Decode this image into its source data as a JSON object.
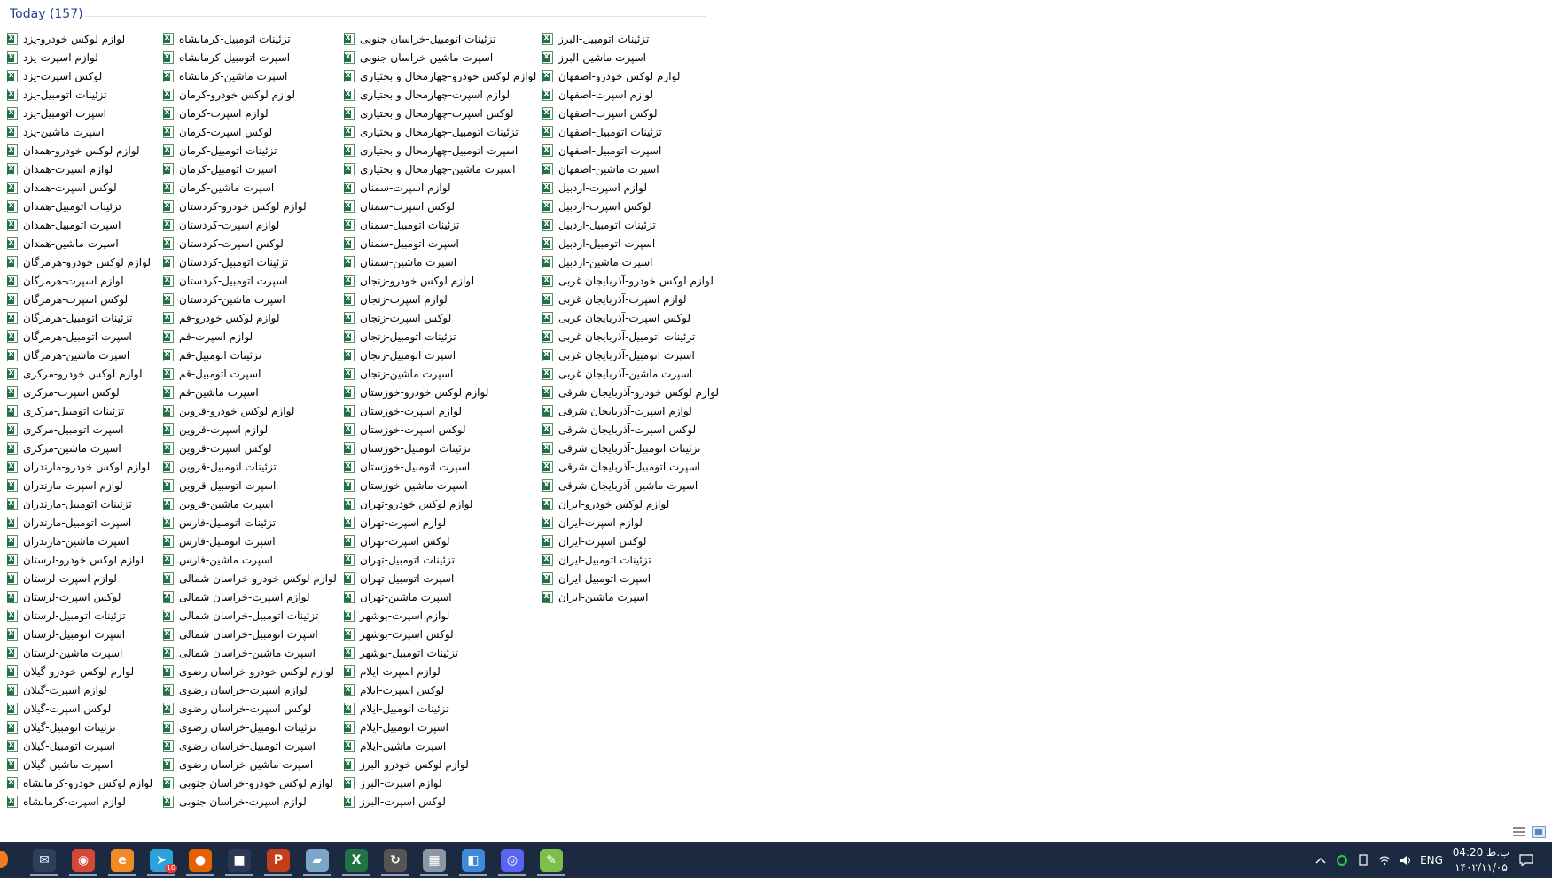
{
  "window": {
    "group_title": "Today (157)"
  },
  "columns": [
    [
      "لوازم لوکس خودرو-یزد",
      "لوازم اسپرت-یزد",
      "لوکس اسپرت-یزد",
      "تزئینات اتومبیل-یزد",
      "اسپرت اتومبیل-یزد",
      "اسپرت ماشین-یزد",
      "لوازم لوکس خودرو-همدان",
      "لوازم اسپرت-همدان",
      "لوکس اسپرت-همدان",
      "تزئینات اتومبیل-همدان",
      "اسپرت اتومبیل-همدان",
      "اسپرت ماشین-همدان",
      "لوازم لوکس خودرو-هرمزگان",
      "لوازم اسپرت-هرمزگان",
      "لوکس اسپرت-هرمزگان",
      "تزئینات اتومبیل-هرمزگان",
      "اسپرت اتومبیل-هرمزگان",
      "اسپرت ماشین-هرمزگان",
      "لوازم لوکس خودرو-مرکزی",
      "لوکس اسپرت-مرکزی",
      "تزئینات اتومبیل-مرکزی",
      "اسپرت اتومبیل-مرکزی",
      "اسپرت ماشین-مرکزی",
      "لوازم لوکس خودرو-مازندران",
      "لوازم اسپرت-مازندران",
      "تزئینات اتومبیل-مازندران",
      "اسپرت اتومبیل-مازندران",
      "اسپرت ماشین-مازندران",
      "لوازم لوکس خودرو-لرستان",
      "لوازم اسپرت-لرستان",
      "لوکس اسپرت-لرستان",
      "تزئینات اتومبیل-لرستان",
      "اسپرت اتومبیل-لرستان",
      "اسپرت ماشین-لرستان",
      "لوازم لوکس خودرو-گیلان",
      "لوازم اسپرت-گیلان",
      "لوکس اسپرت-گیلان",
      "تزئینات اتومبیل-گیلان",
      "اسپرت اتومبیل-گیلان",
      "اسپرت ماشین-گیلان",
      "لوازم لوکس خودرو-کرمانشاه",
      "لوازم اسپرت-کرمانشاه"
    ],
    [
      "تزئینات اتومبیل-کرمانشاه",
      "اسپرت اتومبیل-کرمانشاه",
      "اسپرت ماشین-کرمانشاه",
      "لوازم لوکس خودرو-کرمان",
      "لوازم اسپرت-کرمان",
      "لوکس اسپرت-کرمان",
      "تزئینات اتومبیل-کرمان",
      "اسپرت اتومبیل-کرمان",
      "اسپرت ماشین-کرمان",
      "لوازم لوکس خودرو-کردستان",
      "لوازم اسپرت-کردستان",
      "لوکس اسپرت-کردستان",
      "تزئینات اتومبیل-کردستان",
      "اسپرت اتومبیل-کردستان",
      "اسپرت ماشین-کردستان",
      "لوازم لوکس خودرو-قم",
      "لوازم اسپرت-قم",
      "تزئینات اتومبیل-قم",
      "اسپرت اتومبیل-قم",
      "اسپرت ماشین-قم",
      "لوازم لوکس خودرو-قزوین",
      "لوازم اسپرت-قزوین",
      "لوکس اسپرت-قزوین",
      "تزئینات اتومبیل-قزوین",
      "اسپرت اتومبیل-قزوین",
      "اسپرت ماشین-قزوین",
      "تزئینات اتومبیل-فارس",
      "اسپرت اتومبیل-فارس",
      "اسپرت ماشین-فارس",
      "لوازم لوکس خودرو-خراسان شمالی",
      "لوازم اسپرت-خراسان شمالی",
      "تزئینات اتومبیل-خراسان شمالی",
      "اسپرت اتومبیل-خراسان شمالی",
      "اسپرت ماشین-خراسان شمالی",
      "لوازم لوکس خودرو-خراسان رضوی",
      "لوازم اسپرت-خراسان رضوی",
      "لوکس اسپرت-خراسان رضوی",
      "تزئینات اتومبیل-خراسان رضوی",
      "اسپرت اتومبیل-خراسان رضوی",
      "اسپرت ماشین-خراسان رضوی",
      "لوازم لوکس خودرو-خراسان جنوبی",
      "لوازم اسپرت-خراسان جنوبی"
    ],
    [
      "تزئینات اتومبیل-خراسان جنوبی",
      "اسپرت ماشین-خراسان جنوبی",
      "لوازم لوکس خودرو-چهارمحال و بختیاری",
      "لوازم اسپرت-چهارمحال و بختیاری",
      "لوکس اسپرت-چهارمحال و بختیاری",
      "تزئینات اتومبیل-چهارمحال و بختیاری",
      "اسپرت اتومبیل-چهارمحال و بختیاری",
      "اسپرت ماشین-چهارمحال و بختیاری",
      "لوازم اسپرت-سمنان",
      "لوکس اسپرت-سمنان",
      "تزئینات اتومبیل-سمنان",
      "اسپرت اتومبیل-سمنان",
      "اسپرت ماشین-سمنان",
      "لوازم لوکس خودرو-زنجان",
      "لوازم اسپرت-زنجان",
      "لوکس اسپرت-زنجان",
      "تزئینات اتومبیل-زنجان",
      "اسپرت اتومبیل-زنجان",
      "اسپرت ماشین-زنجان",
      "لوازم لوکس خودرو-خوزستان",
      "لوازم اسپرت-خوزستان",
      "لوکس اسپرت-خوزستان",
      "تزئینات اتومبیل-خوزستان",
      "اسپرت اتومبیل-خوزستان",
      "اسپرت ماشین-خوزستان",
      "لوازم لوکس خودرو-تهران",
      "لوازم اسپرت-تهران",
      "لوکس اسپرت-تهران",
      "تزئینات اتومبیل-تهران",
      "اسپرت اتومبیل-تهران",
      "اسپرت ماشین-تهران",
      "لوازم اسپرت-بوشهر",
      "لوکس اسپرت-بوشهر",
      "تزئینات اتومبیل-بوشهر",
      "لوازم اسپرت-ایلام",
      "لوکس اسپرت-ایلام",
      "تزئینات اتومبیل-ایلام",
      "اسپرت اتومبیل-ایلام",
      "اسپرت ماشین-ایلام",
      "لوازم لوکس خودرو-البرز",
      "لوازم اسپرت-البرز",
      "لوکس اسپرت-البرز"
    ],
    [
      "تزئینات اتومبیل-البرز",
      "اسپرت ماشین-البرز",
      "لوازم لوکس خودرو-اصفهان",
      "لوازم اسپرت-اصفهان",
      "لوکس اسپرت-اصفهان",
      "تزئینات اتومبیل-اصفهان",
      "اسپرت اتومبیل-اصفهان",
      "اسپرت ماشین-اصفهان",
      "لوازم اسپرت-اردبیل",
      "لوکس اسپرت-اردبیل",
      "تزئینات اتومبیل-اردبیل",
      "اسپرت اتومبیل-اردبیل",
      "اسپرت ماشین-اردبیل",
      "لوازم لوکس خودرو-آذربایجان غربی",
      "لوازم اسپرت-آذربایجان غربی",
      "لوکس اسپرت-آذربایجان غربی",
      "تزئینات اتومبیل-آذربایجان غربی",
      "اسپرت اتومبیل-آذربایجان غربی",
      "اسپرت ماشین-آذربایجان غربی",
      "لوازم لوکس خودرو-آذربایجان شرقی",
      "لوازم اسپرت-آذربایجان شرقی",
      "لوکس اسپرت-آذربایجان شرقی",
      "تزئینات اتومبیل-آذربایجان شرقی",
      "اسپرت اتومبیل-آذربایجان شرقی",
      "اسپرت ماشین-آذربایجان شرقی",
      "لوازم لوکس خودرو-ایران",
      "لوازم اسپرت-ایران",
      "لوکس اسپرت-ایران",
      "تزئینات اتومبیل-ایران",
      "اسپرت اتومبیل-ایران",
      "اسپرت ماشین-ایران"
    ]
  ],
  "taskbar": {
    "apps": [
      {
        "name": "mail",
        "glyph": "✉",
        "color": "#2d3f5a"
      },
      {
        "name": "chrome",
        "glyph": "◉",
        "color": "#d34836"
      },
      {
        "name": "edit",
        "glyph": "e",
        "color": "#f08a24"
      },
      {
        "name": "telegram",
        "glyph": "➤",
        "color": "#2aa3dd",
        "badge": "10"
      },
      {
        "name": "firefox",
        "glyph": "●",
        "color": "#e66000"
      },
      {
        "name": "camera",
        "glyph": "■",
        "color": "#2b3a52"
      },
      {
        "name": "powerpoint",
        "glyph": "P",
        "color": "#c43e1c"
      },
      {
        "name": "notebook",
        "glyph": "▰",
        "color": "#7aa6c9"
      },
      {
        "name": "excel",
        "glyph": "X",
        "color": "#1f7344"
      },
      {
        "name": "sync",
        "glyph": "↻",
        "color": "#555"
      },
      {
        "name": "tablet",
        "glyph": "▦",
        "color": "#8c97a6"
      },
      {
        "name": "finder",
        "glyph": "◧",
        "color": "#3c8ad8"
      },
      {
        "name": "discord",
        "glyph": "◎",
        "color": "#5865f2"
      },
      {
        "name": "notepad",
        "glyph": "✎",
        "color": "#7dbf4a"
      }
    ],
    "tray": {
      "lang": "ENG",
      "time": "04:20 ب.ظ",
      "date": "۱۴۰۲/۱۱/۰۵"
    }
  },
  "colors": {
    "header_blue": "#1e3f8f",
    "taskbar_bg": "#1b2a40",
    "excel_green": "#1f7344"
  }
}
